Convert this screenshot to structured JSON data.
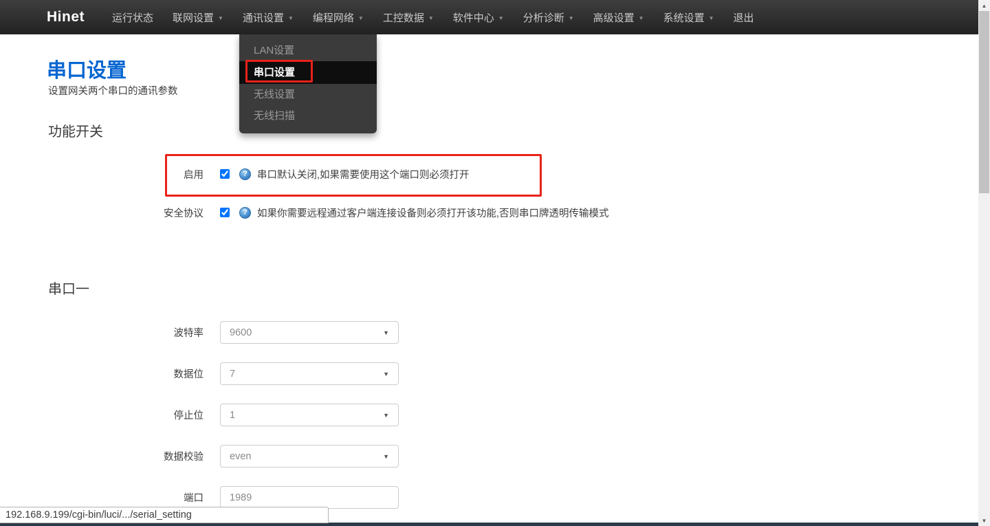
{
  "colors": {
    "accent_blue": "#0766d1",
    "annotation_red": "#e8221a",
    "navbar_dark": "#2a2a2a",
    "dropdown_active_bg": "#0e0e0e",
    "bottom_strip": "#2b3a48"
  },
  "icons": {
    "caret": "▼",
    "help": "?",
    "scroll_up": "▲",
    "scroll_down": "▼"
  },
  "navbar": {
    "brand": "Hinet",
    "items": [
      {
        "label": "运行状态",
        "caret": false
      },
      {
        "label": "联网设置",
        "caret": true
      },
      {
        "label": "通讯设置",
        "caret": true,
        "active": true
      },
      {
        "label": "编程网络",
        "caret": true
      },
      {
        "label": "工控数据",
        "caret": true
      },
      {
        "label": "软件中心",
        "caret": true
      },
      {
        "label": "分析诊断",
        "caret": true
      },
      {
        "label": "高级设置",
        "caret": true
      },
      {
        "label": "系统设置",
        "caret": true
      },
      {
        "label": "退出",
        "caret": false
      }
    ]
  },
  "dropdown": {
    "items": [
      {
        "label": "LAN设置",
        "active": false
      },
      {
        "label": "串口设置",
        "active": true,
        "annotated": true
      },
      {
        "label": "无线设置",
        "active": false
      },
      {
        "label": "无线扫描",
        "active": false
      }
    ]
  },
  "page": {
    "title": "串口设置",
    "subtitle": "设置网关两个串口的通讯参数"
  },
  "function_switches": {
    "heading": "功能开关",
    "rows": [
      {
        "label": "启用",
        "checked": true,
        "help": "串口默认关闭,如果需要使用这个端口则必须打开",
        "annotated": true
      },
      {
        "label": "安全协议",
        "checked": true,
        "help": "如果你需要远程通过客户端连接设备则必须打开该功能,否则串口牌透明传输模式",
        "annotated": false
      }
    ]
  },
  "serial_port_1": {
    "heading": "串口一",
    "fields": [
      {
        "label": "波特率",
        "value": "9600",
        "type": "select"
      },
      {
        "label": "数据位",
        "value": "7",
        "type": "select"
      },
      {
        "label": "停止位",
        "value": "1",
        "type": "select"
      },
      {
        "label": "数据校验",
        "value": "even",
        "type": "select"
      },
      {
        "label": "端口",
        "value": "1989",
        "type": "input"
      }
    ]
  },
  "statusbar": {
    "url": "192.168.9.199/cgi-bin/luci/.../serial_setting"
  }
}
